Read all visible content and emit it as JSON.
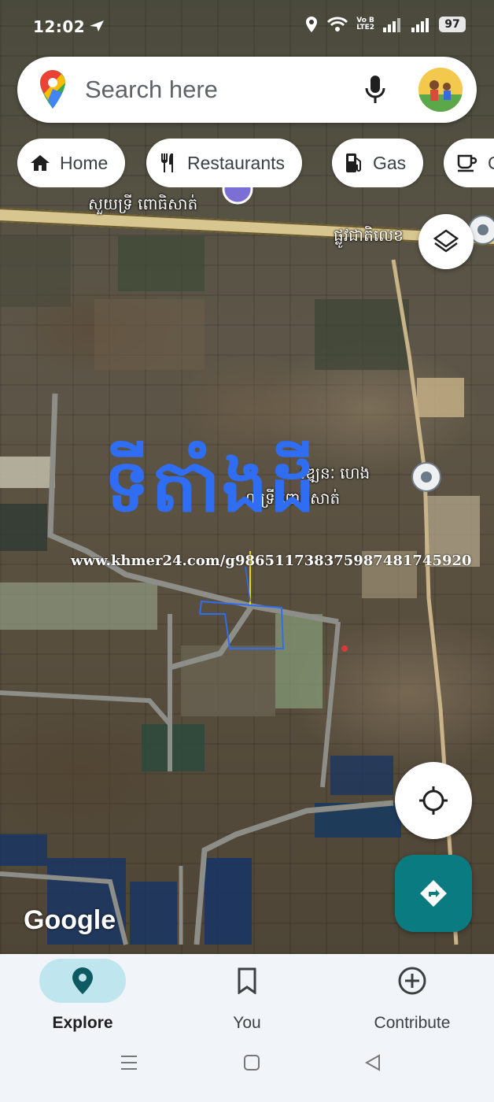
{
  "status_bar": {
    "time": "12:02",
    "network_label_top": "Vo B",
    "network_label_bottom": "LTE2",
    "battery": "97"
  },
  "search": {
    "placeholder": "Search here"
  },
  "chips": [
    {
      "label": "Home",
      "icon": "home-icon"
    },
    {
      "label": "Restaurants",
      "icon": "restaurant-icon"
    },
    {
      "label": "Gas",
      "icon": "gas-station-icon"
    },
    {
      "label": "C",
      "icon": "coffee-icon"
    }
  ],
  "map_labels": {
    "place_top": "សួយទ្រី ពោធិសាត់",
    "road": "ផ្លូវជាតិលេខ",
    "place_right_line1": "វឌ្ឍនៈ ហេង",
    "place_right_line2": "លទ្រី ពោធិសាត់",
    "overlay_title": "ទីតាំងដី",
    "watermark": "www.khmer24.com/g986511738375987481745920",
    "google": "Google"
  },
  "bottom_nav": [
    {
      "label": "Explore",
      "icon": "explore-pin-icon",
      "active": true
    },
    {
      "label": "You",
      "icon": "bookmark-icon",
      "active": false
    },
    {
      "label": "Contribute",
      "icon": "add-circle-icon",
      "active": false
    }
  ],
  "colors": {
    "accent": "#0b7b82",
    "active_tab_bg": "#bfe6ef",
    "overlay_text": "#2f6df2"
  }
}
